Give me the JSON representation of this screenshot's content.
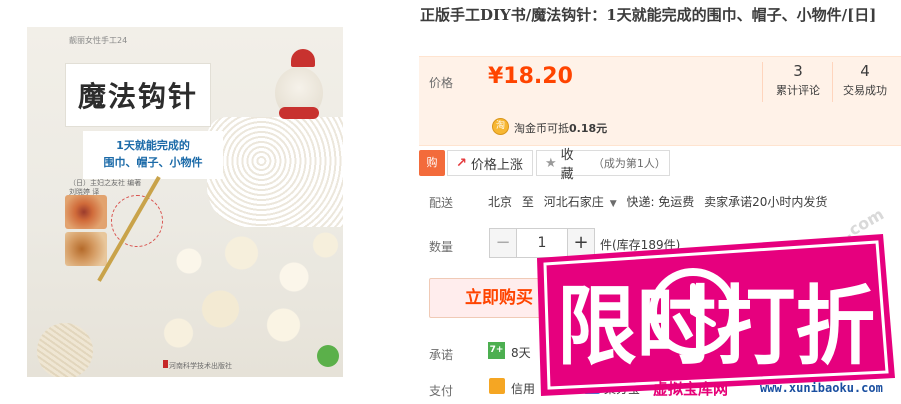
{
  "cover": {
    "series": "靓丽女性手工24",
    "title": "魔法钩针",
    "subtitle_line1": "1天就能完成的",
    "subtitle_line2": "围巾、帽子、小物件",
    "authors_line1": "（日）主妇之友社  编著",
    "authors_line2": "刘晓婷  译",
    "publisher": "河南科学技术出版社"
  },
  "product": {
    "title": "正版手工DIY书/魔法钩针：1天就能完成的围巾、帽子、小物件/[日]",
    "price_label": "价格",
    "price": "¥18.20",
    "reviews_count": "3",
    "reviews_label": "累计评论",
    "deals_count": "4",
    "deals_label": "交易成功",
    "coin_icon_text": "淘",
    "coin_prefix": "淘金币可抵",
    "coin_amount": "0.18元"
  },
  "actions": {
    "buy_icon_text": "购",
    "price_alert": "价格上涨",
    "favorite": "收藏",
    "favorite_note": "（成为第1人）"
  },
  "shipping": {
    "label": "配送",
    "from": "北京",
    "to_word": "至",
    "to": "河北石家庄",
    "method": "快递: 免运费",
    "promise": "卖家承诺20小时内发货"
  },
  "quantity": {
    "label": "数量",
    "minus": "−",
    "value": "1",
    "plus": "+",
    "stock": "件(库存189件)"
  },
  "buy_now": "立即购买",
  "promise": {
    "label": "承诺",
    "icon_text": "7+",
    "text": "8天"
  },
  "payment": {
    "label": "支付",
    "credit": "信用",
    "jifen": "集分宝"
  },
  "promo": {
    "text": "限时打折",
    "site_cn": "虚拟宝库网",
    "site_url": "www.xunibaoku.com",
    "watermark": ".com"
  },
  "colors": {
    "price": "#ff4400",
    "promo_pink": "#e6007e",
    "price_bg": "#fff2e8"
  }
}
